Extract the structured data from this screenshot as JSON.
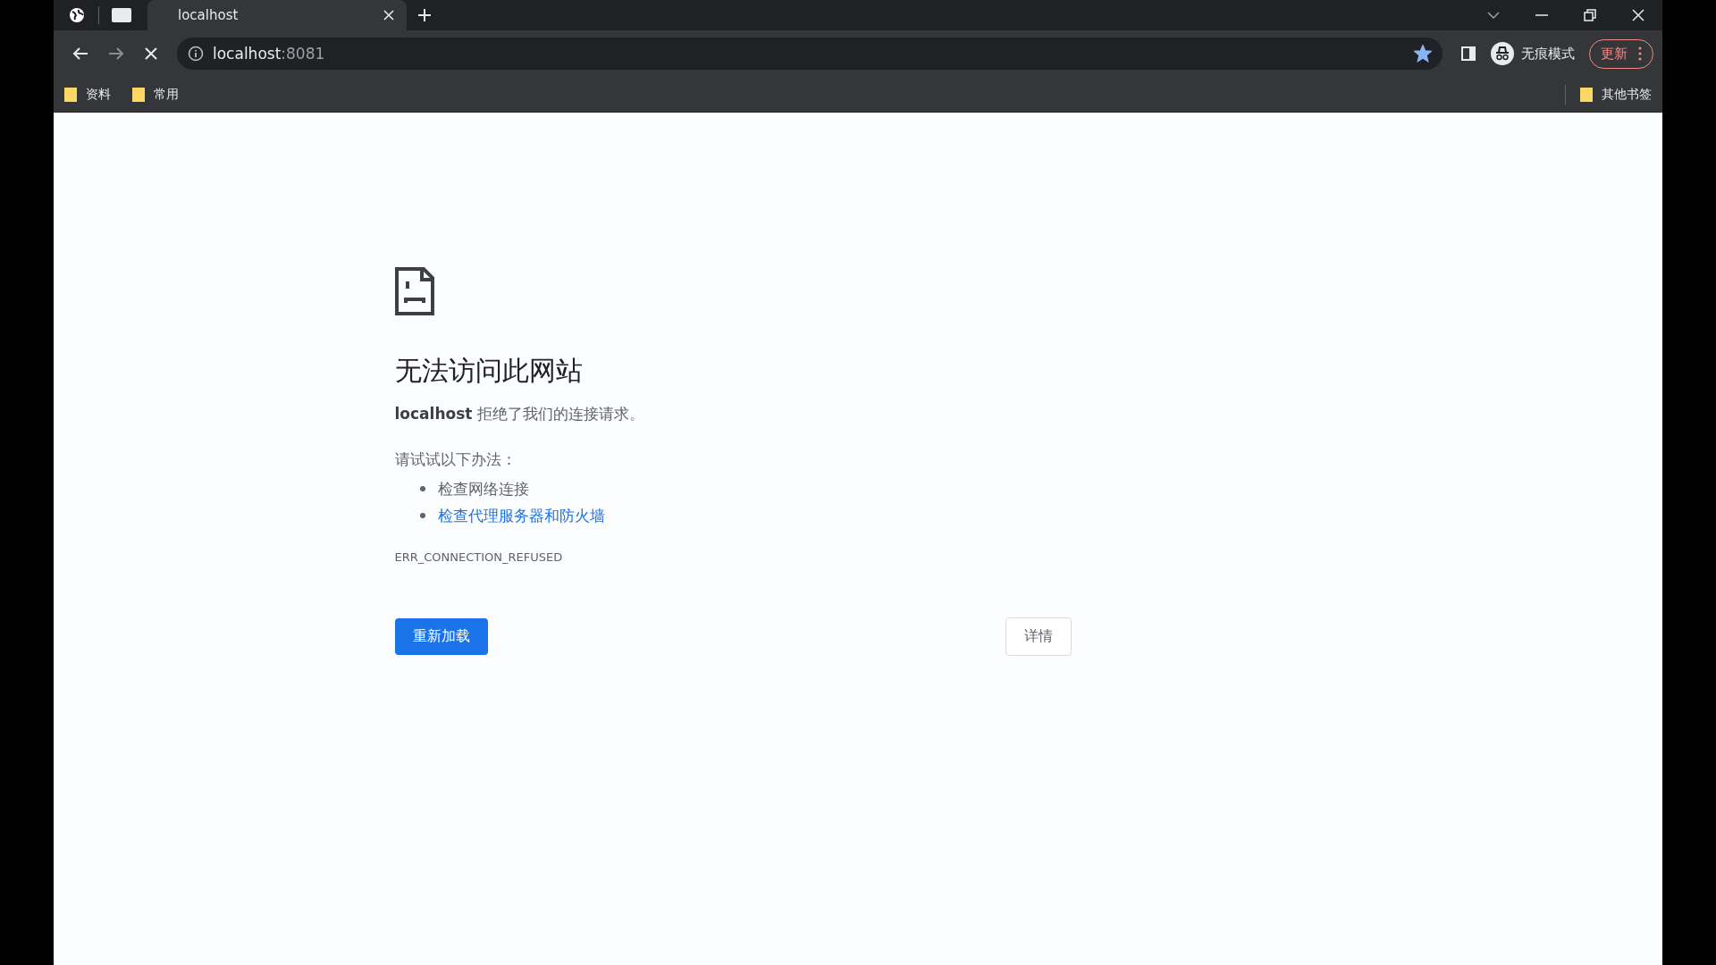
{
  "tabs": [
    {
      "title": "localhost",
      "selected": true
    }
  ],
  "address": {
    "host": "localhost",
    "port": ":8081"
  },
  "bookmarked": true,
  "profile": {
    "label": "无痕模式"
  },
  "update_button": {
    "label": "更新"
  },
  "bookmarks": [
    {
      "label": "资料"
    },
    {
      "label": "常用"
    }
  ],
  "other_bookmarks": {
    "label": "其他书签"
  },
  "error_page": {
    "title": "无法访问此网站",
    "message": "**localhost** 拒绝了我们的连接请求。",
    "suggestions_heading": "请试试以下办法：",
    "suggestions": [
      {
        "text": "检查网络连接",
        "kind": "text"
      },
      {
        "text": "检查代理服务器和防火墙",
        "kind": "link"
      }
    ],
    "error_code": "ERR_CONNECTION_REFUSED",
    "reload_button": "重新加载",
    "details_button": "详情"
  }
}
